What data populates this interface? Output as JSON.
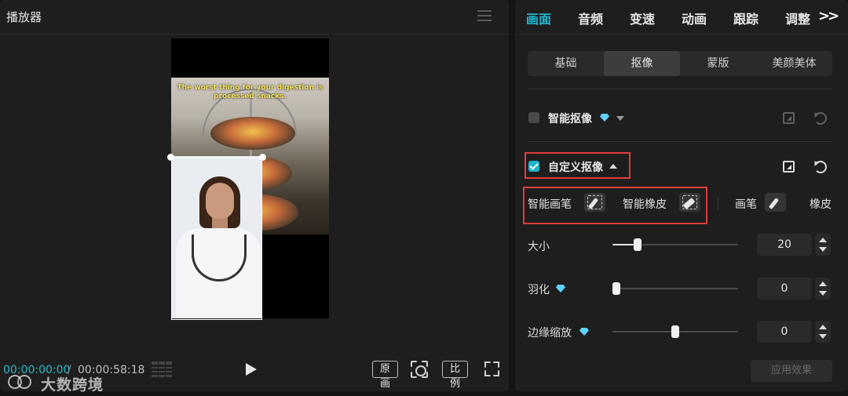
{
  "player": {
    "title": "播放器",
    "video_caption": "The worst thing for your digestion is processed snacks.",
    "time_current": "00:00:00:00",
    "time_separator": "/",
    "time_total": "00:00:58:18",
    "btn_original": "原画",
    "btn_ratio": "比例"
  },
  "watermark": {
    "text": "大数跨境"
  },
  "props": {
    "tabs": [
      "画面",
      "音频",
      "变速",
      "动画",
      "跟踪",
      "调整"
    ],
    "active_tab": "画面",
    "more": ">>",
    "subtabs": [
      "基础",
      "抠像",
      "蒙版",
      "美颜美体"
    ],
    "active_subtab": "抠像",
    "smart_cutout": {
      "label": "智能抠像",
      "checked": false
    },
    "custom_cutout": {
      "label": "自定义抠像",
      "checked": true
    },
    "tools": {
      "smart_brush": "智能画笔",
      "smart_eraser": "智能橡皮",
      "brush": "画笔",
      "eraser": "橡皮"
    },
    "size": {
      "label": "大小",
      "value": "20",
      "fraction": 0.2
    },
    "feather": {
      "label": "羽化",
      "value": "0",
      "fraction": 0.0
    },
    "edge_scale": {
      "label": "边缘缩放",
      "value": "0",
      "fraction": 0.5
    },
    "apply_label": "应用效果"
  },
  "colors": {
    "accent": "#23b8d0",
    "highlight_box": "#e23b3b",
    "panel_bg": "#1e1e1e"
  }
}
